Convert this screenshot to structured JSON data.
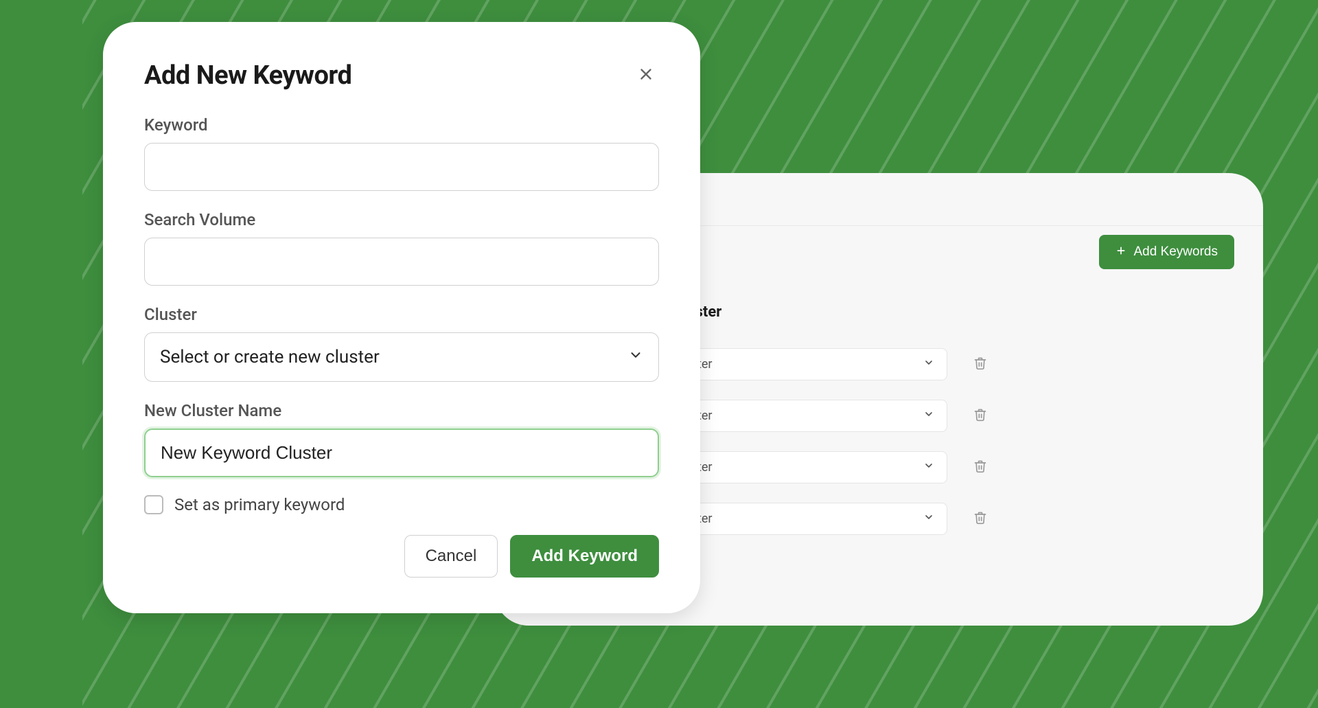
{
  "colors": {
    "accent": "#3e8e3e",
    "accent_light": "#8fcf8f"
  },
  "bg_panel": {
    "toolbar": {
      "add_keywords_label": "Add Keywords"
    },
    "table": {
      "column_header": "Add to Cluster",
      "rows": [
        {
          "select_label": "Select cluster"
        },
        {
          "select_label": "Select cluster"
        },
        {
          "select_label": "Select cluster"
        },
        {
          "select_label": "Select cluster"
        }
      ]
    }
  },
  "modal": {
    "title": "Add New Keyword",
    "fields": {
      "keyword_label": "Keyword",
      "keyword_value": "",
      "search_volume_label": "Search Volume",
      "search_volume_value": "",
      "cluster_label": "Cluster",
      "cluster_select_value": "Select or create new cluster",
      "new_cluster_label": "New Cluster Name",
      "new_cluster_value": "New Keyword Cluster",
      "primary_checkbox_label": "Set as primary keyword",
      "primary_checkbox_checked": false
    },
    "actions": {
      "cancel_label": "Cancel",
      "submit_label": "Add Keyword"
    }
  },
  "icons": {
    "plus": "plus-icon",
    "close": "close-icon",
    "chevron_down": "chevron-down-icon",
    "trash": "trash-icon"
  }
}
